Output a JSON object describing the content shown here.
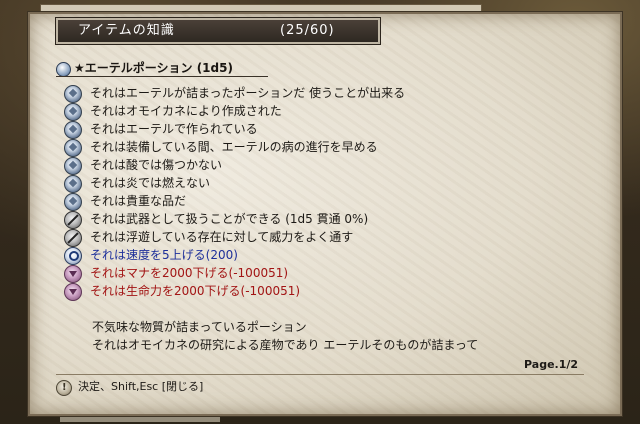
{
  "window": {
    "title": "アイテムの知識",
    "count": "(25/60)"
  },
  "item": {
    "name": "★エーテルポーション (1d5)"
  },
  "properties": [
    {
      "icon": "diamond-icon",
      "text": "それはエーテルが詰まったポーションだ 使うことが出来る",
      "color": "#1d1a16"
    },
    {
      "icon": "diamond-icon",
      "text": "それはオモイカネにより作成された",
      "color": "#1d1a16"
    },
    {
      "icon": "diamond-icon",
      "text": "それはエーテルで作られている",
      "color": "#1d1a16"
    },
    {
      "icon": "diamond-icon",
      "text": "それは装備している間、エーテルの病の進行を早める",
      "color": "#1d1a16"
    },
    {
      "icon": "diamond-icon",
      "text": "それは酸では傷つかない",
      "color": "#1d1a16"
    },
    {
      "icon": "diamond-icon",
      "text": "それは炎では燃えない",
      "color": "#1d1a16"
    },
    {
      "icon": "diamond-icon",
      "text": "それは貴重な品だ",
      "color": "#1d1a16"
    },
    {
      "icon": "sword-icon",
      "text": "それは武器として扱うことができる (1d5 貫通 0%)",
      "color": "#1d1a16"
    },
    {
      "icon": "sword-icon",
      "text": "それは浮遊している存在に対して威力をよく通す",
      "color": "#1d1a16"
    },
    {
      "icon": "wrench-icon",
      "text": "それは速度を5上げる(200)",
      "color": "#1d2f9a"
    },
    {
      "icon": "down-arrow-icon",
      "text": "それはマナを2000下げる(-100051)",
      "color": "#a21414"
    },
    {
      "icon": "down-arrow-icon",
      "text": "それは生命力を2000下げる(-100051)",
      "color": "#a21414"
    }
  ],
  "description": [
    "不気味な物質が詰まっているポーション",
    "それはオモイカネの研究による産物であり エーテルそのものが詰まって"
  ],
  "page": "Page.1/2",
  "footer": {
    "hint": "決定、Shift,Esc [閉じる]"
  }
}
